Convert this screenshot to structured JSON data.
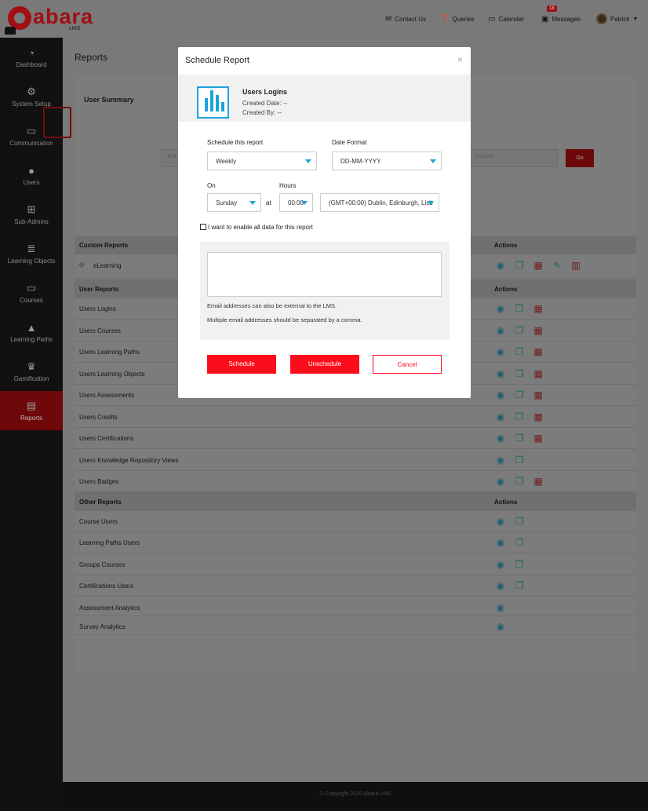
{
  "brand": {
    "logo_text": "abara",
    "logo_sub": "LMS"
  },
  "topnav": {
    "contact": "Contact Us",
    "queries": "Queries",
    "calendar": "Calendar",
    "messages": "Messages",
    "messages_count": "18",
    "user": "Patrick"
  },
  "sidebar": {
    "items": [
      {
        "label": "Dashboard",
        "icon": "dashboard-icon"
      },
      {
        "label": "System Setup",
        "icon": "gear-icon"
      },
      {
        "label": "Communication",
        "icon": "inbox-icon"
      },
      {
        "label": "Users",
        "icon": "users-icon"
      },
      {
        "label": "Sub-Admins",
        "icon": "sitemap-icon"
      },
      {
        "label": "Learning Objects",
        "icon": "server-icon"
      },
      {
        "label": "Courses",
        "icon": "monitor-icon"
      },
      {
        "label": "Learning Paths",
        "icon": "road-icon"
      },
      {
        "label": "Gamification",
        "icon": "trophy-icon"
      },
      {
        "label": "Reports",
        "icon": "document-icon"
      }
    ]
  },
  "page": {
    "title": "Reports",
    "summary_title": "User Summary",
    "input_placeholder_left": "Ent",
    "input_placeholder_right": "Course",
    "go": "Go"
  },
  "custom_reports": {
    "header": "Custom Reports",
    "actions": "Actions",
    "rows": [
      {
        "label": "eLearning"
      }
    ]
  },
  "user_reports": {
    "header": "User Reports",
    "actions": "Actions",
    "rows": [
      {
        "label": "Users Logins",
        "cal": true
      },
      {
        "label": "Users Courses",
        "cal": true
      },
      {
        "label": "Users Learning Paths",
        "cal": true
      },
      {
        "label": "Users Learning Objects",
        "cal": true
      },
      {
        "label": "Users Assessments",
        "cal": true
      },
      {
        "label": "Users Credits",
        "cal": true
      },
      {
        "label": "Users Certifications",
        "cal": true
      },
      {
        "label": "Users Knowledge Repository Views",
        "cal": false
      },
      {
        "label": "Users Badges",
        "cal": true
      }
    ]
  },
  "other_reports": {
    "header": "Other Reports",
    "actions": "Actions",
    "rows": [
      {
        "label": "Course Users",
        "copy": true
      },
      {
        "label": "Learning Paths Users",
        "copy": true
      },
      {
        "label": "Groups Courses",
        "copy": true
      },
      {
        "label": "Certifications Users",
        "copy": true
      },
      {
        "label": "Assessment Analytics",
        "copy": false
      },
      {
        "label": "Survey Analytics",
        "copy": false
      }
    ]
  },
  "footer": "© Copyright 2020 Abara LMS",
  "modal": {
    "title": "Schedule Report",
    "close": "×",
    "report_name": "Users Logins",
    "created_date": "Created Date: --",
    "created_by": "Created By: --",
    "schedule_label": "Schedule this report",
    "schedule_value": "Weekly",
    "date_format_label": "Date Format",
    "date_format_value": "DD-MM-YYYY",
    "on_label": "On",
    "on_value": "Sunday",
    "at_label": "at",
    "hours_label": "Hours",
    "hours_value": "00:00",
    "timezone_value": "(GMT+00:00) Dublin, Edinburgh, Lisb",
    "enable_all_label": "I want to enable all data for this report",
    "note_1": "Email addresses can also be external to the LMS.",
    "note_2": "Multiple email addresses should be separated by a comma.",
    "schedule_btn": "Schedule",
    "unschedule_btn": "Unschedule",
    "cancel_btn": "Cancel"
  }
}
